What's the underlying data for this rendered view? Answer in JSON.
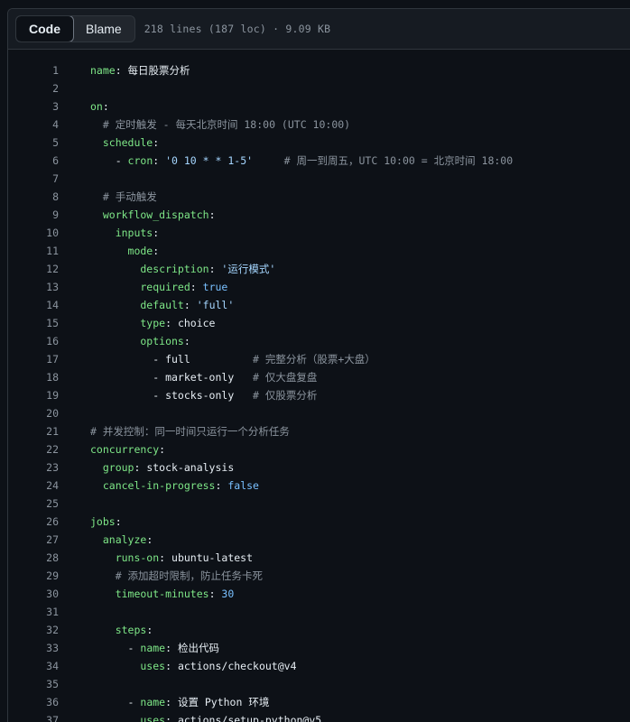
{
  "toolbar": {
    "tab_code": "Code",
    "tab_blame": "Blame",
    "file_info": "218 lines (187 loc) · 9.09 KB"
  },
  "lines": [
    {
      "n": "1",
      "t": [
        [
          "k",
          "name"
        ],
        [
          "p",
          ": 每日股票分析"
        ]
      ]
    },
    {
      "n": "2",
      "t": []
    },
    {
      "n": "3",
      "t": [
        [
          "k",
          "on"
        ],
        [
          "p",
          ":"
        ]
      ]
    },
    {
      "n": "4",
      "t": [
        [
          "c",
          "  # 定时触发 - 每天北京时间 18:00 (UTC 10:00)"
        ]
      ]
    },
    {
      "n": "5",
      "t": [
        [
          "k",
          "  schedule"
        ],
        [
          "p",
          ":"
        ]
      ]
    },
    {
      "n": "6",
      "t": [
        [
          "p",
          "    - "
        ],
        [
          "k",
          "cron"
        ],
        [
          "p",
          ": "
        ],
        [
          "s",
          "'0 10 * * 1-5'"
        ],
        [
          "c",
          "     # 周一到周五，UTC 10:00 = 北京时间 18:00"
        ]
      ]
    },
    {
      "n": "7",
      "t": []
    },
    {
      "n": "8",
      "t": [
        [
          "c",
          "  # 手动触发"
        ]
      ]
    },
    {
      "n": "9",
      "t": [
        [
          "k",
          "  workflow_dispatch"
        ],
        [
          "p",
          ":"
        ]
      ]
    },
    {
      "n": "10",
      "t": [
        [
          "k",
          "    inputs"
        ],
        [
          "p",
          ":"
        ]
      ]
    },
    {
      "n": "11",
      "t": [
        [
          "k",
          "      mode"
        ],
        [
          "p",
          ":"
        ]
      ]
    },
    {
      "n": "12",
      "t": [
        [
          "k",
          "        description"
        ],
        [
          "p",
          ": "
        ],
        [
          "s",
          "'运行模式'"
        ]
      ]
    },
    {
      "n": "13",
      "t": [
        [
          "k",
          "        required"
        ],
        [
          "p",
          ": "
        ],
        [
          "b",
          "true"
        ]
      ]
    },
    {
      "n": "14",
      "t": [
        [
          "k",
          "        default"
        ],
        [
          "p",
          ": "
        ],
        [
          "s",
          "'full'"
        ]
      ]
    },
    {
      "n": "15",
      "t": [
        [
          "k",
          "        type"
        ],
        [
          "p",
          ": choice"
        ]
      ]
    },
    {
      "n": "16",
      "t": [
        [
          "k",
          "        options"
        ],
        [
          "p",
          ":"
        ]
      ]
    },
    {
      "n": "17",
      "t": [
        [
          "p",
          "          - full          "
        ],
        [
          "c",
          "# 完整分析（股票+大盘）"
        ]
      ]
    },
    {
      "n": "18",
      "t": [
        [
          "p",
          "          - market-only   "
        ],
        [
          "c",
          "# 仅大盘复盘"
        ]
      ]
    },
    {
      "n": "19",
      "t": [
        [
          "p",
          "          - stocks-only   "
        ],
        [
          "c",
          "# 仅股票分析"
        ]
      ]
    },
    {
      "n": "20",
      "t": []
    },
    {
      "n": "21",
      "t": [
        [
          "c",
          "# 并发控制：同一时间只运行一个分析任务"
        ]
      ]
    },
    {
      "n": "22",
      "t": [
        [
          "k",
          "concurrency"
        ],
        [
          "p",
          ":"
        ]
      ]
    },
    {
      "n": "23",
      "t": [
        [
          "k",
          "  group"
        ],
        [
          "p",
          ": stock-analysis"
        ]
      ]
    },
    {
      "n": "24",
      "t": [
        [
          "k",
          "  cancel-in-progress"
        ],
        [
          "p",
          ": "
        ],
        [
          "b",
          "false"
        ]
      ]
    },
    {
      "n": "25",
      "t": []
    },
    {
      "n": "26",
      "t": [
        [
          "k",
          "jobs"
        ],
        [
          "p",
          ":"
        ]
      ]
    },
    {
      "n": "27",
      "t": [
        [
          "k",
          "  analyze"
        ],
        [
          "p",
          ":"
        ]
      ]
    },
    {
      "n": "28",
      "t": [
        [
          "k",
          "    runs-on"
        ],
        [
          "p",
          ": ubuntu-latest"
        ]
      ]
    },
    {
      "n": "29",
      "t": [
        [
          "c",
          "    # 添加超时限制，防止任务卡死"
        ]
      ]
    },
    {
      "n": "30",
      "t": [
        [
          "k",
          "    timeout-minutes"
        ],
        [
          "p",
          ": "
        ],
        [
          "b",
          "30"
        ]
      ]
    },
    {
      "n": "31",
      "t": []
    },
    {
      "n": "32",
      "t": [
        [
          "k",
          "    steps"
        ],
        [
          "p",
          ":"
        ]
      ]
    },
    {
      "n": "33",
      "t": [
        [
          "p",
          "      - "
        ],
        [
          "k",
          "name"
        ],
        [
          "p",
          ": 检出代码"
        ]
      ]
    },
    {
      "n": "34",
      "t": [
        [
          "k",
          "        uses"
        ],
        [
          "p",
          ": actions/checkout@v4"
        ]
      ]
    },
    {
      "n": "35",
      "t": []
    },
    {
      "n": "36",
      "t": [
        [
          "p",
          "      - "
        ],
        [
          "k",
          "name"
        ],
        [
          "p",
          ": 设置 Python 环境"
        ]
      ]
    },
    {
      "n": "37",
      "t": [
        [
          "k",
          "        uses"
        ],
        [
          "p",
          ": actions/setup-python@v5"
        ]
      ]
    }
  ]
}
